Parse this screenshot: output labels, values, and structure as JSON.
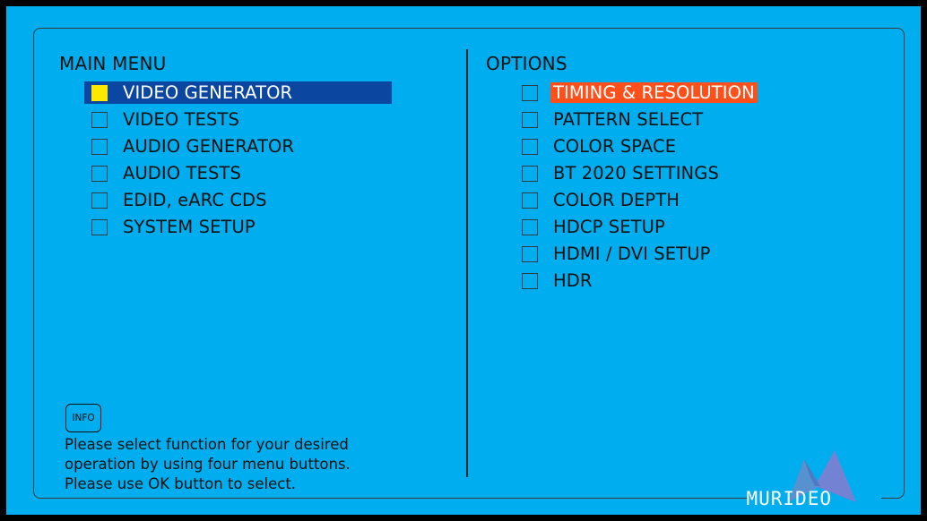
{
  "main_menu": {
    "title": "MAIN MENU",
    "items": [
      {
        "label": "VIDEO GENERATOR",
        "selected": true
      },
      {
        "label": "VIDEO TESTS",
        "selected": false
      },
      {
        "label": "AUDIO GENERATOR",
        "selected": false
      },
      {
        "label": "AUDIO TESTS",
        "selected": false
      },
      {
        "label": "EDID, eARC CDS",
        "selected": false
      },
      {
        "label": "SYSTEM SETUP",
        "selected": false
      }
    ]
  },
  "options": {
    "title": "OPTIONS",
    "items": [
      {
        "label": "TIMING & RESOLUTION",
        "highlighted": true
      },
      {
        "label": "PATTERN SELECT",
        "highlighted": false
      },
      {
        "label": "COLOR SPACE",
        "highlighted": false
      },
      {
        "label": "BT 2020 SETTINGS",
        "highlighted": false
      },
      {
        "label": "COLOR DEPTH",
        "highlighted": false
      },
      {
        "label": "HDCP SETUP",
        "highlighted": false
      },
      {
        "label": "HDMI / DVI SETUP",
        "highlighted": false
      },
      {
        "label": "HDR",
        "highlighted": false
      }
    ]
  },
  "info": {
    "button_label": "INFO",
    "help_lines": [
      "Please select function for your desired",
      "operation by using four menu buttons.",
      "Please use OK button to select."
    ]
  },
  "brand": {
    "name": "MURIDEO"
  },
  "colors": {
    "background": "#00adee",
    "selected_row": "#0b47a1",
    "checked_box": "#ffe800",
    "highlight": "#ff4f1a"
  }
}
